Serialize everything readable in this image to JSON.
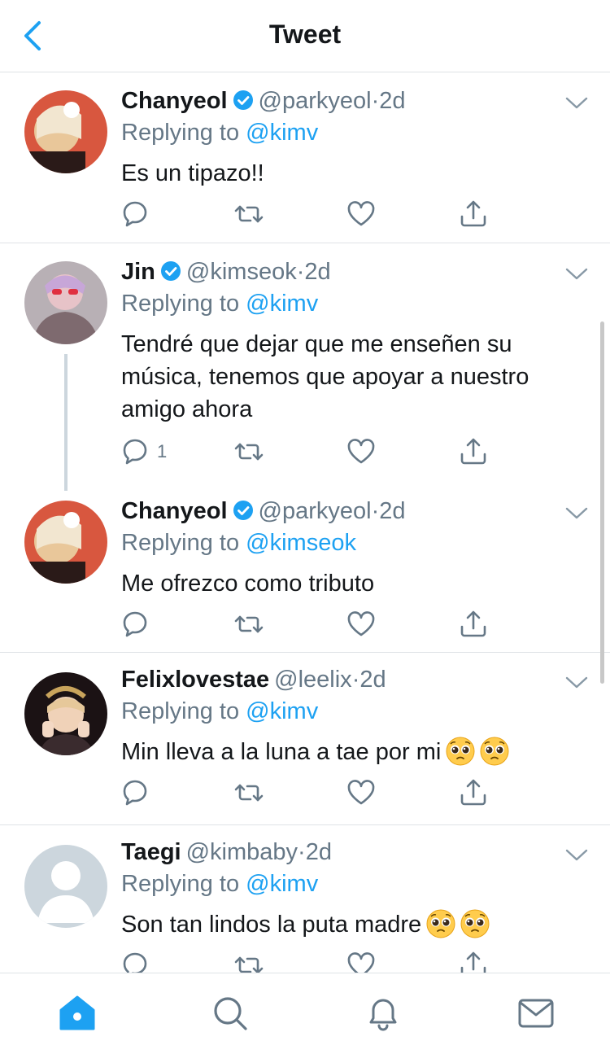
{
  "header": {
    "title": "Tweet",
    "accent": "#1da1f2"
  },
  "tweets": [
    {
      "name": "Chanyeol",
      "verified": true,
      "handle": "@parkyeol",
      "sep": "·",
      "time": "2d",
      "replying_prefix": "Replying to ",
      "replying_to": "@kimv",
      "text": "Es un tipazo!!",
      "reply_count": ""
    },
    {
      "name": "Jin",
      "verified": true,
      "handle": "@kimseok",
      "sep": "·",
      "time": "2d",
      "replying_prefix": "Replying to ",
      "replying_to": "@kimv",
      "text": "Tendré que dejar que me enseñen su música, tenemos que apoyar a nuestro amigo ahora",
      "reply_count": "1"
    },
    {
      "name": "Chanyeol",
      "verified": true,
      "handle": "@parkyeol",
      "sep": "·",
      "time": "2d",
      "replying_prefix": "Replying to ",
      "replying_to": "@kimseok",
      "text": "Me ofrezco como tributo",
      "reply_count": ""
    },
    {
      "name": "Felixlovestae",
      "verified": false,
      "handle": "@leelix",
      "sep": "·",
      "time": "2d",
      "replying_prefix": "Replying to ",
      "replying_to": "@kimv",
      "text": "Min lleva a la luna a tae por mi",
      "reply_count": ""
    },
    {
      "name": "Taegi",
      "verified": false,
      "handle": "@kimbaby",
      "sep": "·",
      "time": "2d",
      "replying_prefix": "Replying to ",
      "replying_to": "@kimv",
      "text": "Son tan lindos la puta madre",
      "reply_count": ""
    }
  ],
  "icons": {
    "reply": "reply-icon",
    "retweet": "retweet-icon",
    "like": "heart-icon",
    "share": "share-icon",
    "tabs": [
      "home-icon",
      "search-icon",
      "notifications-icon",
      "messages-icon"
    ]
  }
}
